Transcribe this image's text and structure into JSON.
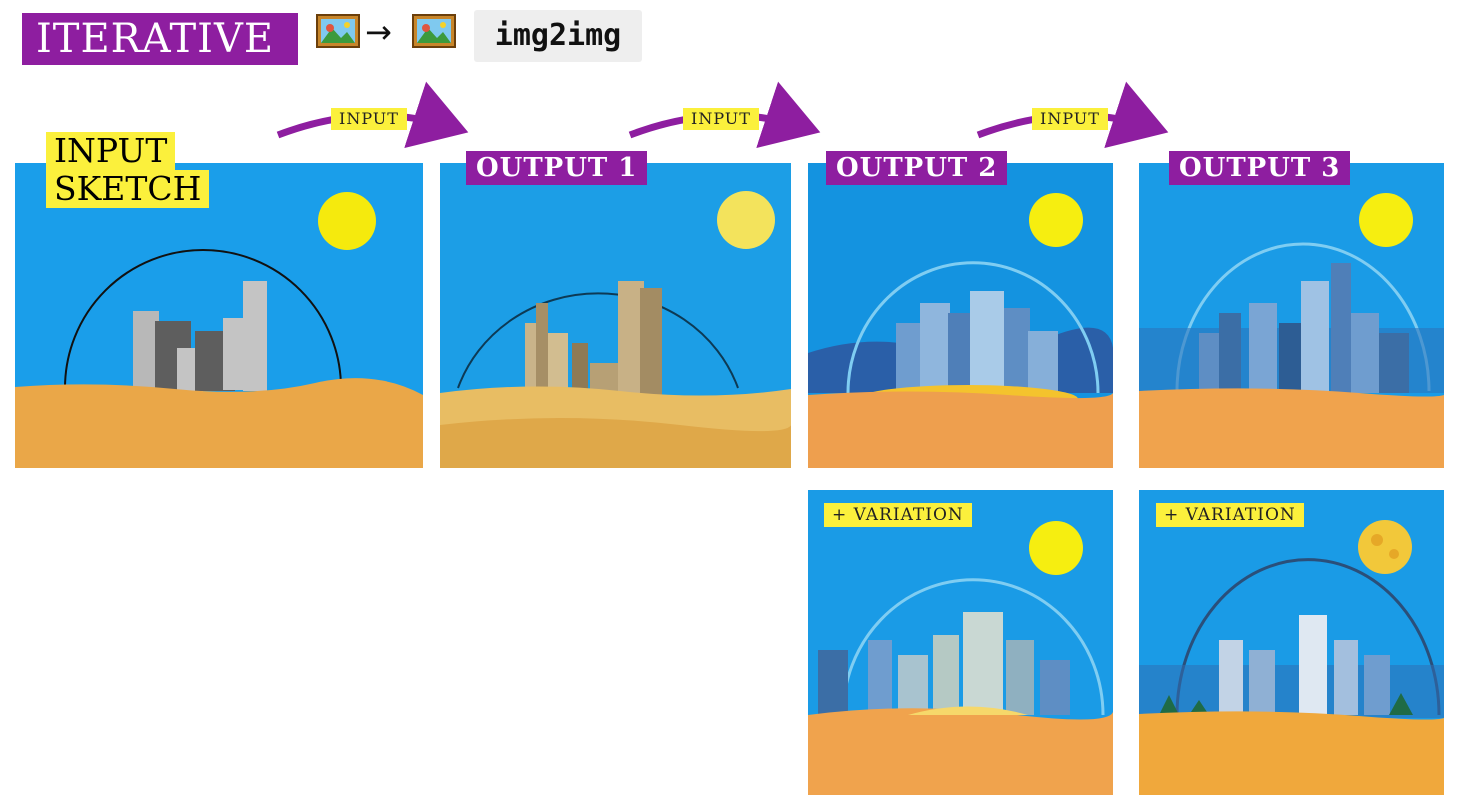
{
  "header": {
    "title": "ITERATIVE",
    "arrow": "→",
    "code": "img2img",
    "icons": [
      "framed-picture-icon",
      "framed-picture-icon"
    ]
  },
  "panels": {
    "sketch_label_line1": "INPUT",
    "sketch_label_line2": "SKETCH",
    "output_1": "OUTPUT 1",
    "output_2": "OUTPUT 2",
    "output_3": "OUTPUT 3"
  },
  "arrows": {
    "input_label": "INPUT"
  },
  "variations": {
    "label": "+ VARIATION"
  },
  "colors": {
    "accent_purple": "#8e1ea0",
    "highlight_yellow": "#fbf03c",
    "sky_blue": "#1a9eea",
    "sand": "#eaa748"
  }
}
